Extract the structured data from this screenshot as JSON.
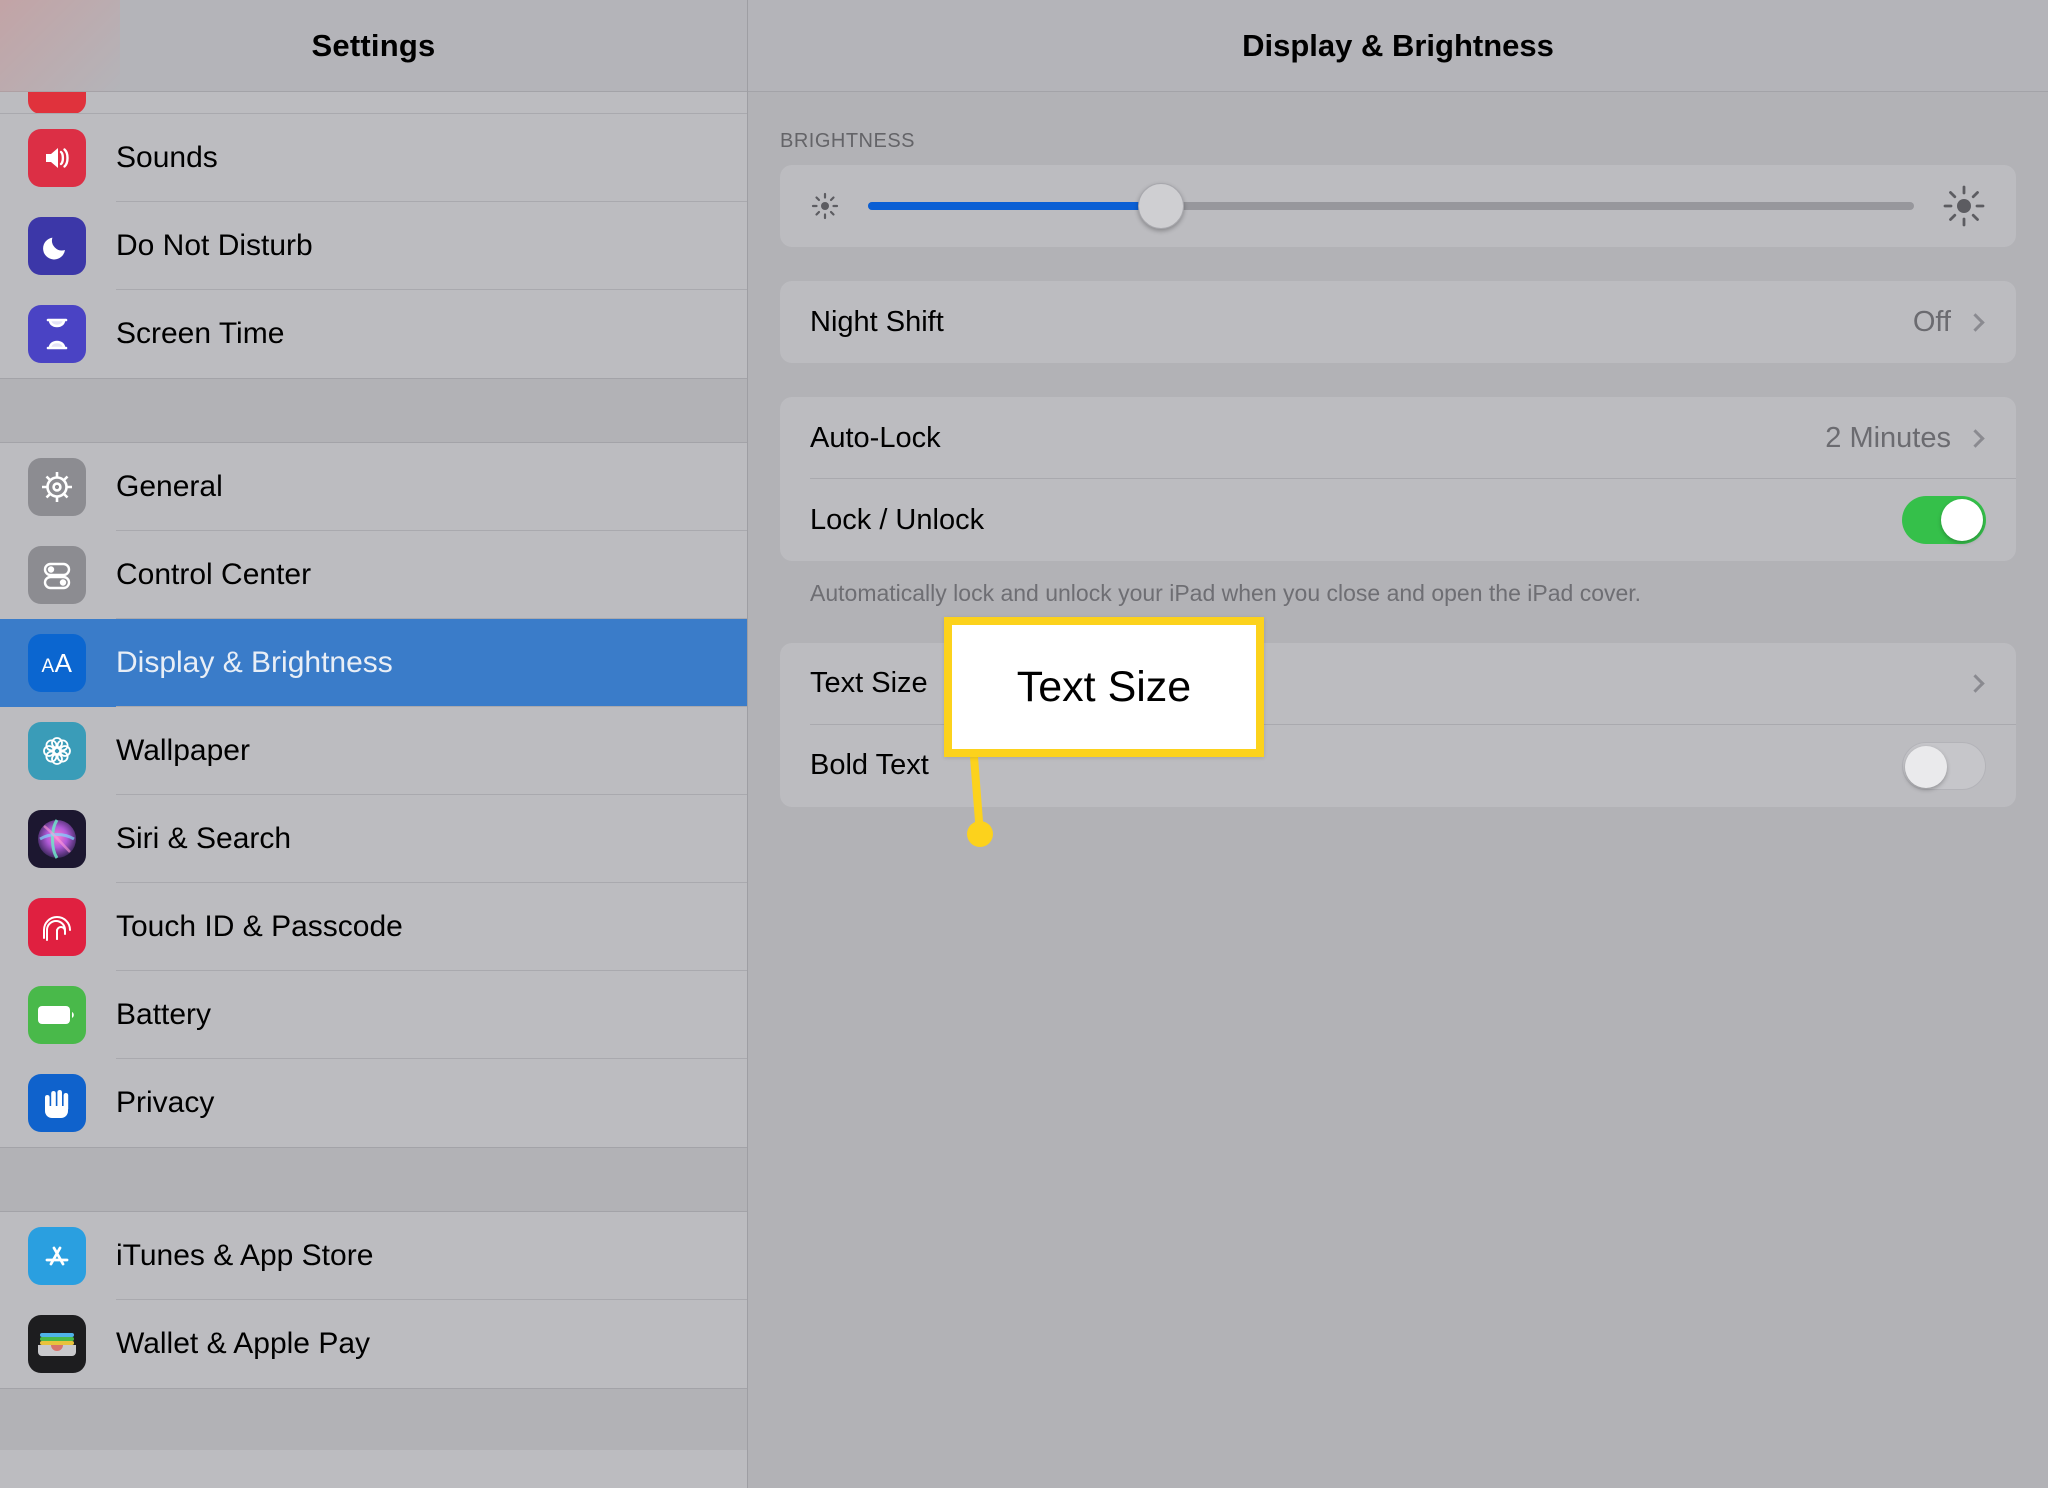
{
  "sidebar": {
    "title": "Settings",
    "partial_item_above": {
      "icon": "clipped-red-app-icon"
    },
    "groups": [
      {
        "items": [
          {
            "label": "Sounds",
            "icon": "speaker-icon",
            "selected": false
          },
          {
            "label": "Do Not Disturb",
            "icon": "moon-icon",
            "selected": false
          },
          {
            "label": "Screen Time",
            "icon": "hourglass-icon",
            "selected": false
          }
        ]
      },
      {
        "items": [
          {
            "label": "General",
            "icon": "gear-icon",
            "selected": false
          },
          {
            "label": "Control Center",
            "icon": "toggles-icon",
            "selected": false
          },
          {
            "label": "Display & Brightness",
            "icon": "text-size-aa-icon",
            "selected": true
          },
          {
            "label": "Wallpaper",
            "icon": "flower-icon",
            "selected": false
          },
          {
            "label": "Siri & Search",
            "icon": "siri-orb-icon",
            "selected": false
          },
          {
            "label": "Touch ID & Passcode",
            "icon": "fingerprint-icon",
            "selected": false
          },
          {
            "label": "Battery",
            "icon": "battery-icon",
            "selected": false
          },
          {
            "label": "Privacy",
            "icon": "hand-icon",
            "selected": false
          }
        ]
      },
      {
        "items": [
          {
            "label": "iTunes & App Store",
            "icon": "app-store-icon",
            "selected": false
          },
          {
            "label": "Wallet & Apple Pay",
            "icon": "wallet-icon",
            "selected": false
          }
        ]
      }
    ]
  },
  "main": {
    "title": "Display & Brightness",
    "brightness": {
      "section_label": "BRIGHTNESS",
      "value_percent": 28,
      "low_icon": "sun-low-icon",
      "high_icon": "sun-high-icon"
    },
    "night_shift": {
      "label": "Night Shift",
      "value": "Off",
      "chevron": "chevron-right-icon"
    },
    "auto_lock": {
      "label": "Auto-Lock",
      "value": "2 Minutes",
      "chevron": "chevron-right-icon"
    },
    "lock_unlock": {
      "label": "Lock / Unlock",
      "toggle_state": "on"
    },
    "lock_footnote": "Automatically lock and unlock your iPad when you close and open the iPad cover.",
    "text_size": {
      "label": "Text Size",
      "chevron": "chevron-right-icon"
    },
    "bold_text": {
      "label": "Bold Text",
      "toggle_state": "off"
    }
  },
  "annotation": {
    "label": "Text Size",
    "color": "#fcd21c"
  }
}
